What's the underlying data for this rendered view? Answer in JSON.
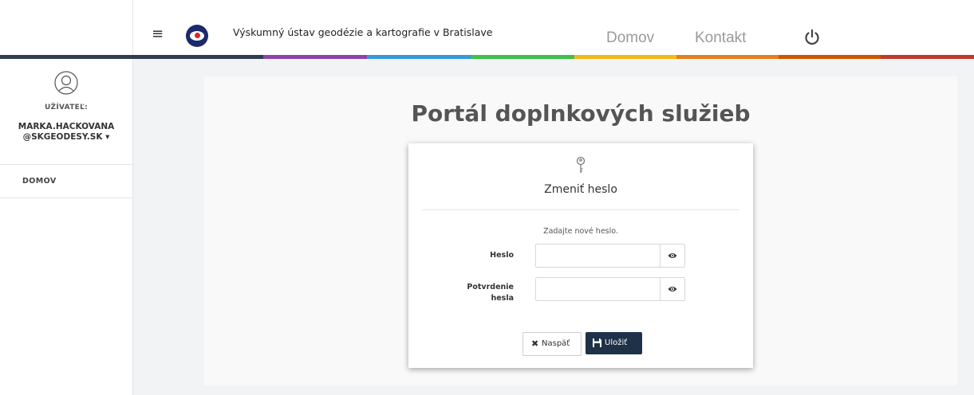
{
  "header": {
    "org_name": "Výskumný ústav geodézie a kartografie v Bratislave",
    "nav": {
      "home": "Domov",
      "contact": "Kontakt"
    },
    "menu_glyph": "≡"
  },
  "color_strip": [
    "#2f3d4e",
    "#8e44ad",
    "#3498db",
    "#3ec14a",
    "#f4b816",
    "#e67e22",
    "#d35400",
    "#c0392b"
  ],
  "sidebar": {
    "user_label": "UŽÍVATEĽ:",
    "user_name_line1": "MARKA.HACKOVANA",
    "user_name_line2": "@SKGEODESY.SK",
    "caret": "▾",
    "items": [
      {
        "label": "DOMOV"
      }
    ]
  },
  "main": {
    "title": "Portál doplnkových služieb",
    "card": {
      "title": "Zmeniť heslo",
      "hint": "Zadajte nové heslo.",
      "password_label": "Heslo",
      "confirm_label_line1": "Potvrdenie",
      "confirm_label_line2": "hesla",
      "password_value": "",
      "confirm_value": "",
      "back_label": "Naspäť",
      "back_icon": "✖",
      "save_label": "Uložiť"
    }
  },
  "icons": {
    "menu": "hamburger-icon",
    "power": "power-icon",
    "user": "user-avatar-icon",
    "key": "key-icon",
    "eye": "eye-icon",
    "save": "floppy-disk-icon"
  }
}
